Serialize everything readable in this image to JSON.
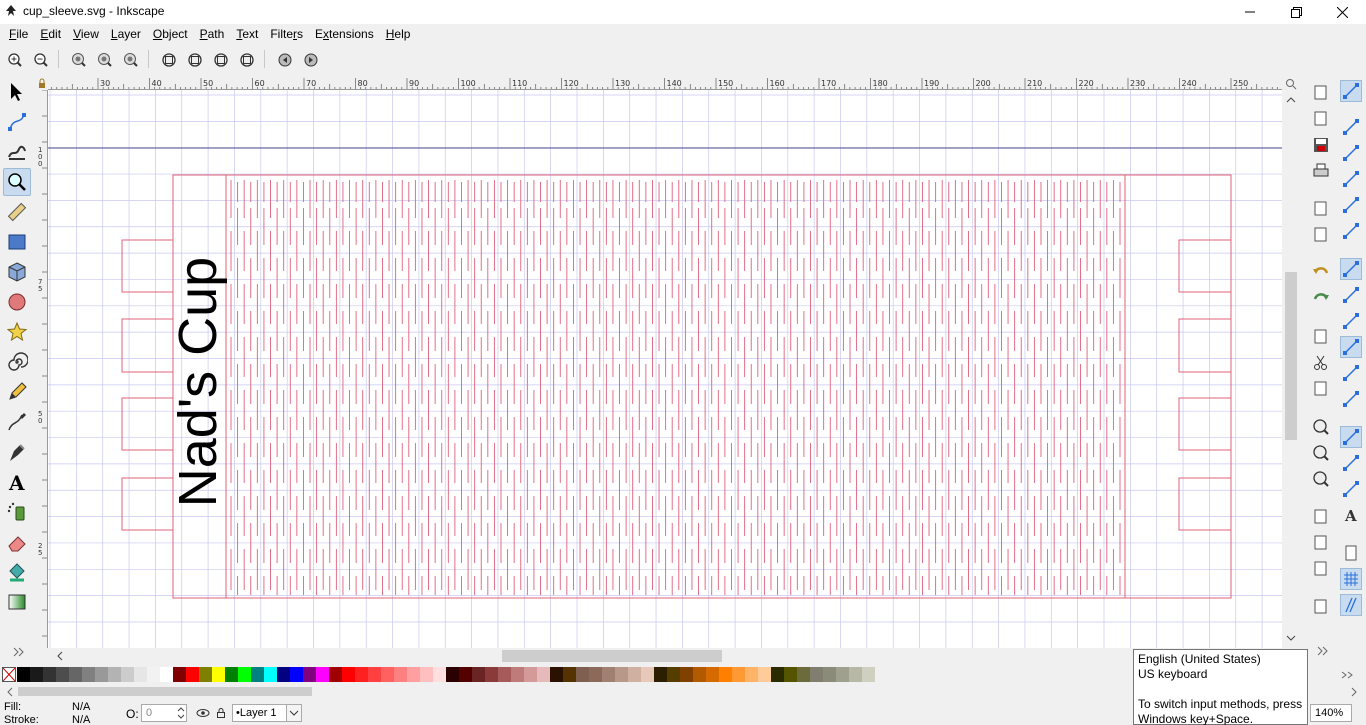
{
  "window": {
    "title": "cup_sleeve.svg - Inkscape"
  },
  "menu": [
    {
      "u": "F",
      "rest": "ile"
    },
    {
      "u": "E",
      "rest": "dit"
    },
    {
      "u": "V",
      "rest": "iew"
    },
    {
      "u": "L",
      "rest": "ayer"
    },
    {
      "u": "O",
      "rest": "bject"
    },
    {
      "u": "P",
      "rest": "ath"
    },
    {
      "u": "T",
      "rest": "ext"
    },
    {
      "u": "",
      "pre": "Filte",
      "uu": "r",
      "rest": "s"
    },
    {
      "u": "",
      "pre": "E",
      "uu": "x",
      "rest": "tensions"
    },
    {
      "u": "H",
      "rest": "elp"
    }
  ],
  "ruler": {
    "h_labels": [
      "30",
      "40",
      "50",
      "60",
      "70",
      "80",
      "90",
      "100",
      "110",
      "120",
      "130",
      "140",
      "150",
      "160",
      "170",
      "180",
      "190",
      "200",
      "210",
      "220",
      "230",
      "240",
      "250"
    ],
    "v_labels": [
      "100",
      "75",
      "50",
      "25"
    ]
  },
  "canvas": {
    "text": "Nad's Cup"
  },
  "palette": {
    "colors": [
      "#000000",
      "#1a1a1a",
      "#333333",
      "#4d4d4d",
      "#666666",
      "#808080",
      "#999999",
      "#b3b3b3",
      "#cccccc",
      "#e6e6e6",
      "#f2f2f2",
      "#ffffff",
      "#800000",
      "#ff0000",
      "#808000",
      "#ffff00",
      "#008000",
      "#00ff00",
      "#008080",
      "#00ffff",
      "#000080",
      "#0000ff",
      "#800080",
      "#ff00ff",
      "#a00000",
      "#ff0000",
      "#ff2020",
      "#ff4040",
      "#ff6060",
      "#ff8080",
      "#ff9f9f",
      "#ffbfbf",
      "#ffdfdf",
      "#2b0000",
      "#550000",
      "#6b2424",
      "#8b3a3a",
      "#a65a5a",
      "#bf7a7a",
      "#d49a9a",
      "#e6baba",
      "#2b1100",
      "#553300",
      "#7f5f4f",
      "#8b6a5a",
      "#a08070",
      "#b89888",
      "#d0b0a0",
      "#e8c8b8",
      "#2b1f00",
      "#553d00",
      "#804000",
      "#b35900",
      "#d46a00",
      "#ff7f00",
      "#ff9933",
      "#ffb366",
      "#ffcc99",
      "#2b2b00",
      "#555500",
      "#6b6b3c",
      "#807f6f",
      "#8b8b7a",
      "#a0a08f",
      "#b8b8a7",
      "#d0d0c0"
    ],
    "x_label": "X"
  },
  "status": {
    "fill_label": "Fill:",
    "fill_value": "N/A",
    "stroke_label": "Stroke:",
    "stroke_value": "N/A",
    "opacity_label": "O:",
    "opacity_value": "0",
    "layer": "•Layer 1",
    "zoom": "140%"
  },
  "tooltip": {
    "line1": "English (United States)",
    "line2": "US keyboard",
    "line3": "To switch input methods, press",
    "line4": "Windows key+Space."
  }
}
